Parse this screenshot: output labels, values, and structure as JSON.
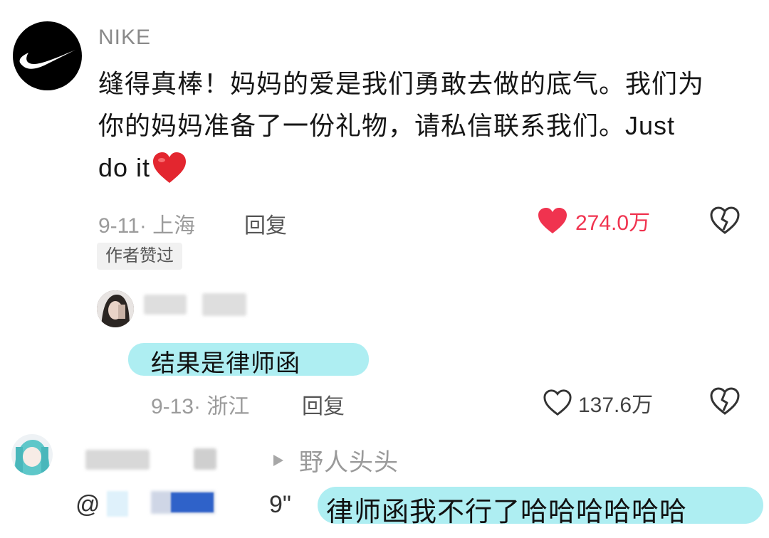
{
  "comment": {
    "author": "NIKE",
    "text_line1": "缝得真棒！妈妈的爱是我们勇敢去做的底气。我们为",
    "text_line2": "你的妈妈准备了一份礼物，请私信联系我们。Just",
    "text_line3": "do it",
    "date_location": "9-11· 上海",
    "reply_label": "回复",
    "like_count": "274.0万",
    "author_liked_tag": "作者赞过",
    "colors": {
      "liked": "#f0334f"
    }
  },
  "reply1": {
    "text": "结果是律师函",
    "date_location": "9-13· 浙江",
    "reply_label": "回复",
    "like_count": "137.6万"
  },
  "reply2": {
    "reply_to_name": "野人头头",
    "mention_prefix": "@",
    "mention_tail": "9\"",
    "text": "律师函我不行了哈哈哈哈哈哈"
  },
  "icons": {
    "logo": "nike-swoosh",
    "like_filled": "heart-filled-icon",
    "like_outline": "heart-outline-icon",
    "dislike": "broken-heart-icon",
    "reply_arrow": "triangle-right-icon",
    "emoji": "red-heart-emoji"
  },
  "highlight_color": "#aeeef2"
}
